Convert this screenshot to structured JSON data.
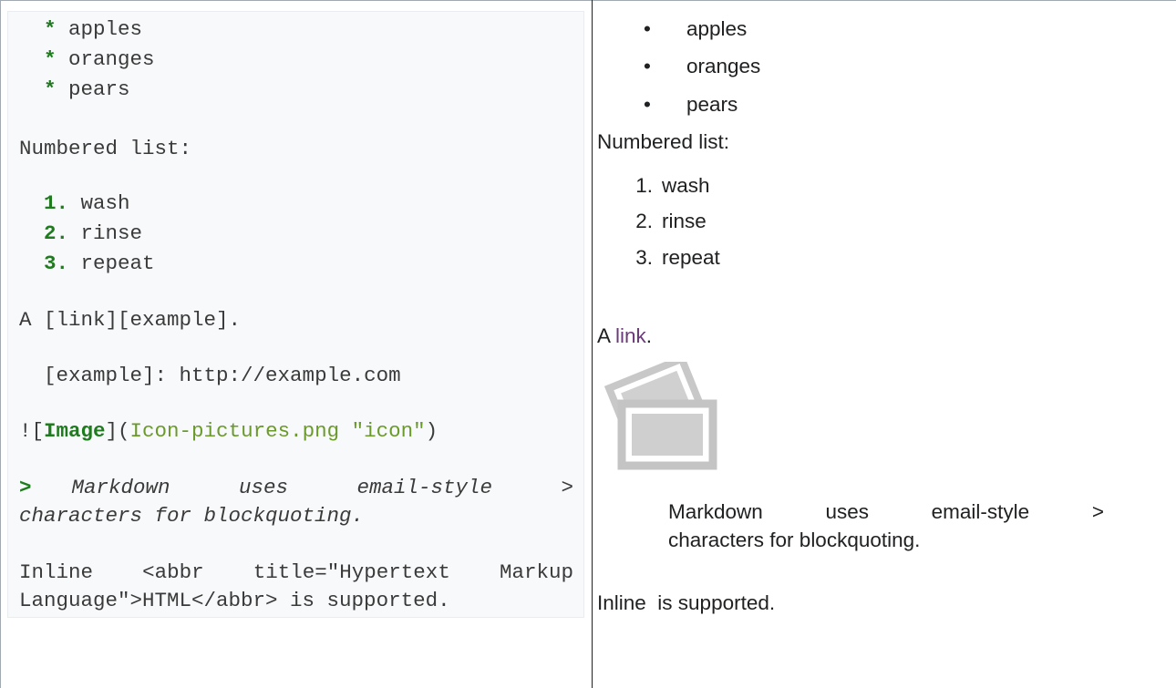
{
  "source": {
    "list_marker": "*",
    "list_items": [
      "apples",
      "oranges",
      "pears"
    ],
    "numbered_heading": "Numbered list:",
    "numbered_items": [
      {
        "marker": "1.",
        "text": "wash"
      },
      {
        "marker": "2.",
        "text": "rinse"
      },
      {
        "marker": "3.",
        "text": "repeat"
      }
    ],
    "link_line": "A [link][example].",
    "ref_def": "[example]: http://example.com",
    "image": {
      "bang_bracket": "![",
      "alt": "Image",
      "close_paren_open": "](",
      "target": "Icon-pictures.png \"icon\"",
      "close": ")"
    },
    "quote": {
      "marker": ">",
      "line1_words": [
        "Markdown",
        "uses",
        "email-style",
        ">"
      ],
      "line2": "characters for blockquoting."
    },
    "inline_html": {
      "line1_words": [
        "Inline",
        "<abbr",
        "title=\"Hypertext",
        "Markup"
      ],
      "line2": "Language\">HTML</abbr> is supported."
    }
  },
  "rendered": {
    "bullet_glyph": "•",
    "list_items": [
      "apples",
      "oranges",
      "pears"
    ],
    "numbered_heading": "Numbered list:",
    "numbered_items": [
      {
        "marker": "1.",
        "text": "wash"
      },
      {
        "marker": "2.",
        "text": "rinse"
      },
      {
        "marker": "3.",
        "text": "repeat"
      }
    ],
    "link_prefix": "A ",
    "link_text": "link",
    "link_suffix": ".",
    "quote_line1_words": [
      "Markdown",
      "uses",
      "email-style",
      ">"
    ],
    "quote_line2": "characters for blockquoting.",
    "inline_text": "Inline  is supported."
  },
  "colors": {
    "code_background": "#f8f9fa",
    "markdown_marker": "#1e7b1e",
    "image_target": "#6a9a2a",
    "visited_link": "#6b3a7a",
    "table_border": "#a2a9b1"
  },
  "icons": [
    "pictures-icon"
  ]
}
